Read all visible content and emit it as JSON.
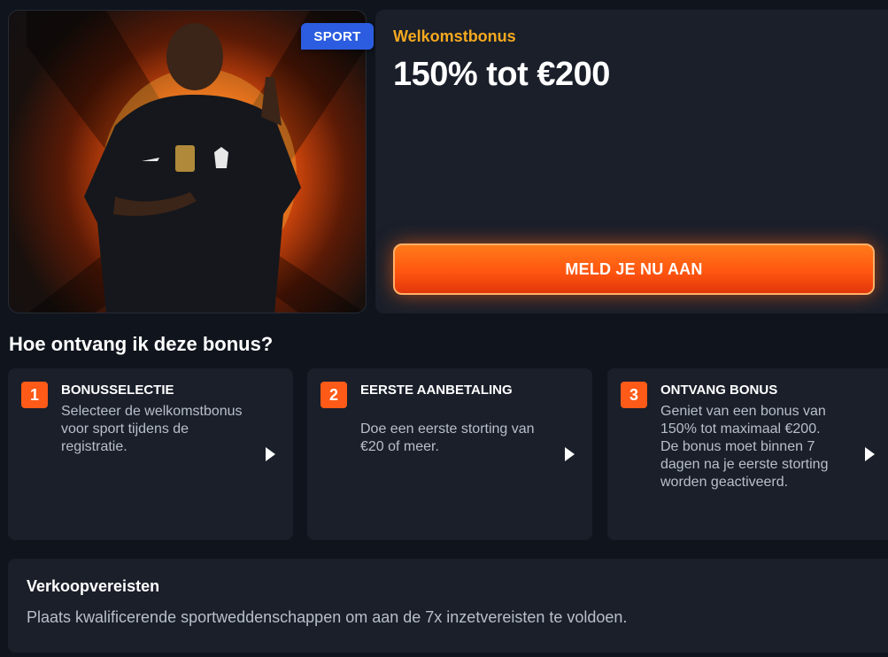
{
  "hero": {
    "badge": "SPORT",
    "image": "footballer-promo-image"
  },
  "bonus": {
    "eyebrow": "Welkomstbonus",
    "title": "150% tot €200",
    "cta_label": "MELD JE NU AAN"
  },
  "how_to": {
    "heading": "Hoe ontvang ik deze bonus?",
    "steps": [
      {
        "number": "1",
        "title": "BONUSSELECTIE",
        "description": "Selecteer de welkomstbonus voor sport tijdens de registratie."
      },
      {
        "number": "2",
        "title": "EERSTE AANBETALING",
        "description": "Doe een eerste storting van €20 of meer."
      },
      {
        "number": "3",
        "title": "ONTVANG BONUS",
        "description": "Geniet van een bonus van 150% tot maximaal €200. De bonus moet binnen 7 dagen na je eerste storting worden geactiveerd."
      }
    ]
  },
  "requirements": {
    "title": "Verkoopvereisten",
    "text": "Plaats kwalificerende sportweddenschappen om aan de 7x inzetvereisten te voldoen."
  },
  "colors": {
    "background": "#0f141d",
    "card": "#1a1f2a",
    "accent_orange": "#ff5a17",
    "eyebrow_gold": "#f5a91f",
    "badge_blue": "#2c5de0"
  }
}
